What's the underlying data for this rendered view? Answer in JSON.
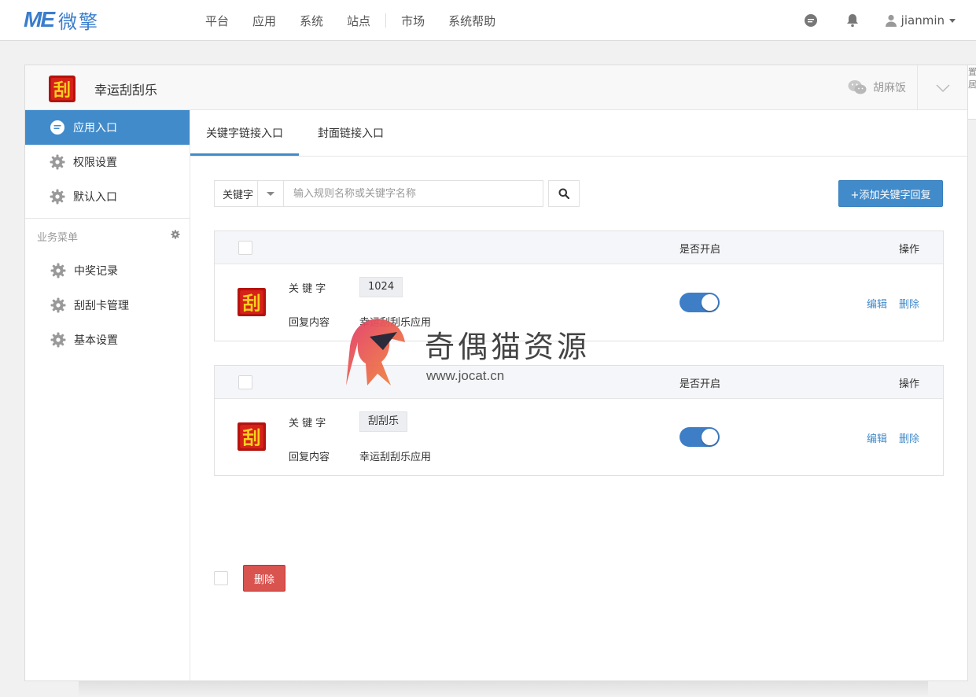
{
  "brand": {
    "logo_me": "ME",
    "logo_cn": "微擎"
  },
  "nav": {
    "items": [
      "平台",
      "应用",
      "系统",
      "站点",
      "市场",
      "系统帮助"
    ]
  },
  "user": {
    "name": "jianmin"
  },
  "app": {
    "title": "幸运刮刮乐",
    "account": "胡麻饭",
    "icon_char": "刮"
  },
  "edge_text": "置\n居",
  "sidebar": {
    "items": [
      {
        "label": "应用入口",
        "icon": "chat-icon",
        "active": true
      },
      {
        "label": "权限设置",
        "icon": "gear-icon"
      },
      {
        "label": "默认入口",
        "icon": "gear-icon"
      }
    ],
    "category": "业务菜单",
    "business_items": [
      {
        "label": "中奖记录",
        "icon": "gear-icon"
      },
      {
        "label": "刮刮卡管理",
        "icon": "gear-icon"
      },
      {
        "label": "基本设置",
        "icon": "gear-icon"
      }
    ]
  },
  "tabs": [
    {
      "label": "关键字链接入口",
      "active": true
    },
    {
      "label": "封面链接入口",
      "active": false
    }
  ],
  "filter": {
    "select_value": "关键字",
    "search_placeholder": "输入规则名称或关键字名称",
    "add_label": "+添加关键字回复"
  },
  "table": {
    "col_enabled": "是否开启",
    "col_ops": "操作"
  },
  "rules": [
    {
      "keyword_label": "关 键 字",
      "keyword": "1024",
      "reply_label": "回复内容",
      "reply": "幸运刮刮乐应用",
      "enabled": true,
      "edit": "编辑",
      "delete": "删除"
    },
    {
      "keyword_label": "关 键 字",
      "keyword": "刮刮乐",
      "reply_label": "回复内容",
      "reply": "幸运刮刮乐应用",
      "enabled": true,
      "edit": "编辑",
      "delete": "删除"
    }
  ],
  "bulk": {
    "delete_label": "删除"
  },
  "watermark": {
    "title": "奇偶猫资源",
    "url": "www.jocat.cn"
  },
  "colors": {
    "primary": "#428bca",
    "danger": "#d9534f",
    "brand": "#3a7dcc"
  }
}
